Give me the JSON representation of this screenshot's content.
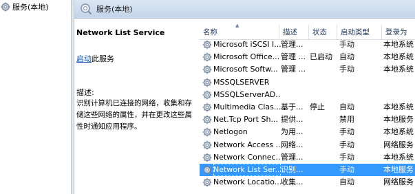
{
  "nav": {
    "tree_label": "服务(本地)"
  },
  "header": {
    "title": "服务(本地)"
  },
  "details": {
    "service_name": "Network List Service",
    "start_link": "启动",
    "start_suffix": "此服务",
    "desc_label": "描述:",
    "desc_text": "识别计算机已连接的网络，收集和存储这些网络的属性，并在更改这些属性时通知应用程序。"
  },
  "columns": {
    "name": "名称",
    "description": "描述",
    "status": "状态",
    "startup": "启动类型",
    "logon": "登录为"
  },
  "colors": {
    "selected_row": "#3399ff",
    "header_gradient_top": "#dae6f3",
    "link": "#0a4fb2"
  },
  "services": [
    {
      "name": "Microsoft iSCSI I...",
      "description": "管理...",
      "status": "",
      "startup": "手动",
      "logon": "本地系统"
    },
    {
      "name": "Microsoft Office...",
      "description": "管理 ...",
      "status": "已启动",
      "startup": "自动",
      "logon": "本地系统"
    },
    {
      "name": "Microsoft Softw...",
      "description": "管理 ...",
      "status": "",
      "startup": "手动",
      "logon": "本地系统"
    },
    {
      "name": "MSSQLSERVER",
      "description": "",
      "status": "",
      "startup": "",
      "logon": ""
    },
    {
      "name": "MSSQLServerAD...",
      "description": "",
      "status": "",
      "startup": "",
      "logon": ""
    },
    {
      "name": "Multimedia Clas...",
      "description": "基于...",
      "status": "停止",
      "startup": "自动",
      "logon": "本地系统"
    },
    {
      "name": "Net.Tcp Port Sh...",
      "description": "提供...",
      "status": "",
      "startup": "禁用",
      "logon": "本地服务"
    },
    {
      "name": "Netlogon",
      "description": "为用...",
      "status": "",
      "startup": "手动",
      "logon": "本地系统"
    },
    {
      "name": "Network Access ...",
      "description": "网络...",
      "status": "",
      "startup": "手动",
      "logon": "网络服务"
    },
    {
      "name": "Network Connec...",
      "description": "管理...",
      "status": "",
      "startup": "手动",
      "logon": "本地系统"
    },
    {
      "name": "Network List Ser...",
      "description": "识别...",
      "status": "",
      "startup": "手动",
      "logon": "本地服务",
      "selected": true
    },
    {
      "name": "Network Locatio...",
      "description": "收集...",
      "status": "",
      "startup": "自动",
      "logon": "网络服务"
    }
  ]
}
